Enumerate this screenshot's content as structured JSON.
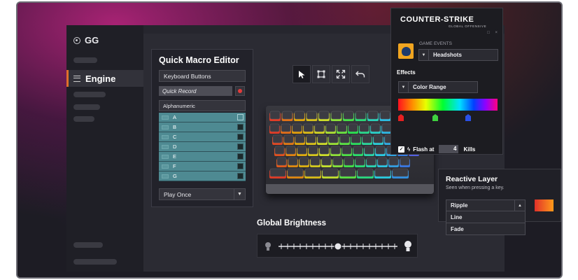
{
  "sidebar": {
    "app_name": "GG",
    "active_item": "Engine"
  },
  "macro_editor": {
    "title": "Quick Macro Editor",
    "keyboard_buttons": "Keyboard Buttons",
    "quick_record": "Quick Record",
    "category": "Alphanumeric",
    "keys": [
      {
        "label": "A",
        "checked": true
      },
      {
        "label": "B",
        "checked": false
      },
      {
        "label": "C",
        "checked": false
      },
      {
        "label": "D",
        "checked": false
      },
      {
        "label": "E",
        "checked": false
      },
      {
        "label": "F",
        "checked": false
      },
      {
        "label": "G",
        "checked": false
      }
    ],
    "playback": "Play Once"
  },
  "toolbar": {
    "icons": [
      "pointer-icon",
      "select-box-icon",
      "expand-icon",
      "undo-icon"
    ]
  },
  "brightness": {
    "title": "Global Brightness",
    "level": 0.5
  },
  "game_panel": {
    "logo_line1": "COUNTER-STRIKE",
    "logo_line2": "GLOBAL OFFENSIVE",
    "events_label": "GAME EVENTS",
    "event_value": "Headshots",
    "effects_label": "Effects",
    "effect_value": "Color Range",
    "flash_label": "Flash at",
    "flash_value": "4",
    "flash_unit": "Kills"
  },
  "reactive_layer": {
    "title": "Reactive Layer",
    "subtitle": "Seen when pressing a key.",
    "selected": "Ripple",
    "options": [
      "Line",
      "Fade"
    ]
  },
  "colors": {
    "accent": "#e0702a",
    "key_rows": "#4e8a92",
    "record": "#e23b3b"
  }
}
